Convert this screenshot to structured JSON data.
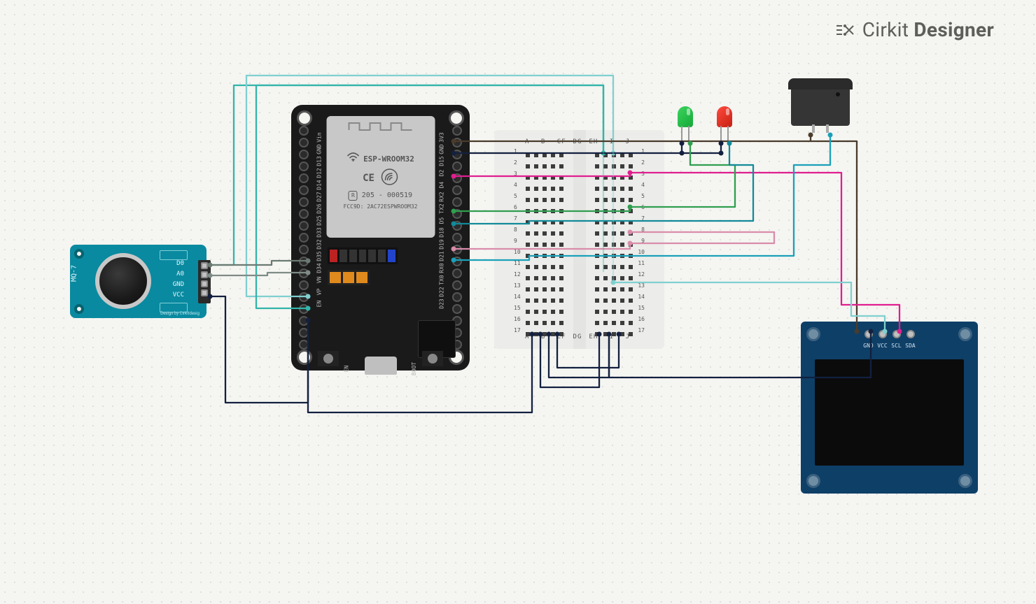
{
  "app": {
    "brand": "Cirkit",
    "product": "Designer"
  },
  "components": {
    "mq7": {
      "name": "MQ-7",
      "pins": [
        "D0",
        "A0",
        "GND",
        "VCC"
      ],
      "footer": "Design by Cirkitdesig"
    },
    "esp32": {
      "shield_title": "ESP-WROOM32",
      "certs": "CE",
      "id_line": "205 - 000519",
      "fcc": "FCC9D: 2AC72ESPWROOM32",
      "pins_left": [
        "Vin",
        "GND",
        "D13",
        "D12",
        "D14",
        "D27",
        "D26",
        "D25",
        "D33",
        "D32",
        "D35",
        "D34",
        "VN",
        "VP",
        "EN"
      ],
      "pins_right": [
        "3V3",
        "GND",
        "D15",
        "D2",
        "D4",
        "RX2",
        "TX2",
        "D5",
        "D18",
        "D19",
        "D21",
        "RX0",
        "TX0",
        "D22",
        "D23"
      ],
      "btn_left": "EN",
      "btn_right": "BOOT"
    },
    "breadboard": {
      "cols_left": "A B C D E",
      "cols_right": "F G H I J",
      "rows": 17
    },
    "leds": {
      "green": "LED-green",
      "red": "LED-red"
    },
    "buzzer": {
      "name": "Buzzer"
    },
    "oled": {
      "pins": [
        "GND",
        "VCC",
        "SCL",
        "SDA"
      ]
    }
  },
  "wires": {
    "colors": {
      "navy": "#13203f",
      "teal": "#32b5a9",
      "slate": "#6b7a72",
      "gray": "#7f8b86",
      "lightteal": "#7fd0cf",
      "brown": "#4a3b2b",
      "magenta": "#e01e8f",
      "green": "#2f9e4f",
      "pink": "#d98caa",
      "cyan": "#1aa0b8",
      "darkcyan": "#128a99",
      "blue": "#0b4f8e"
    }
  }
}
